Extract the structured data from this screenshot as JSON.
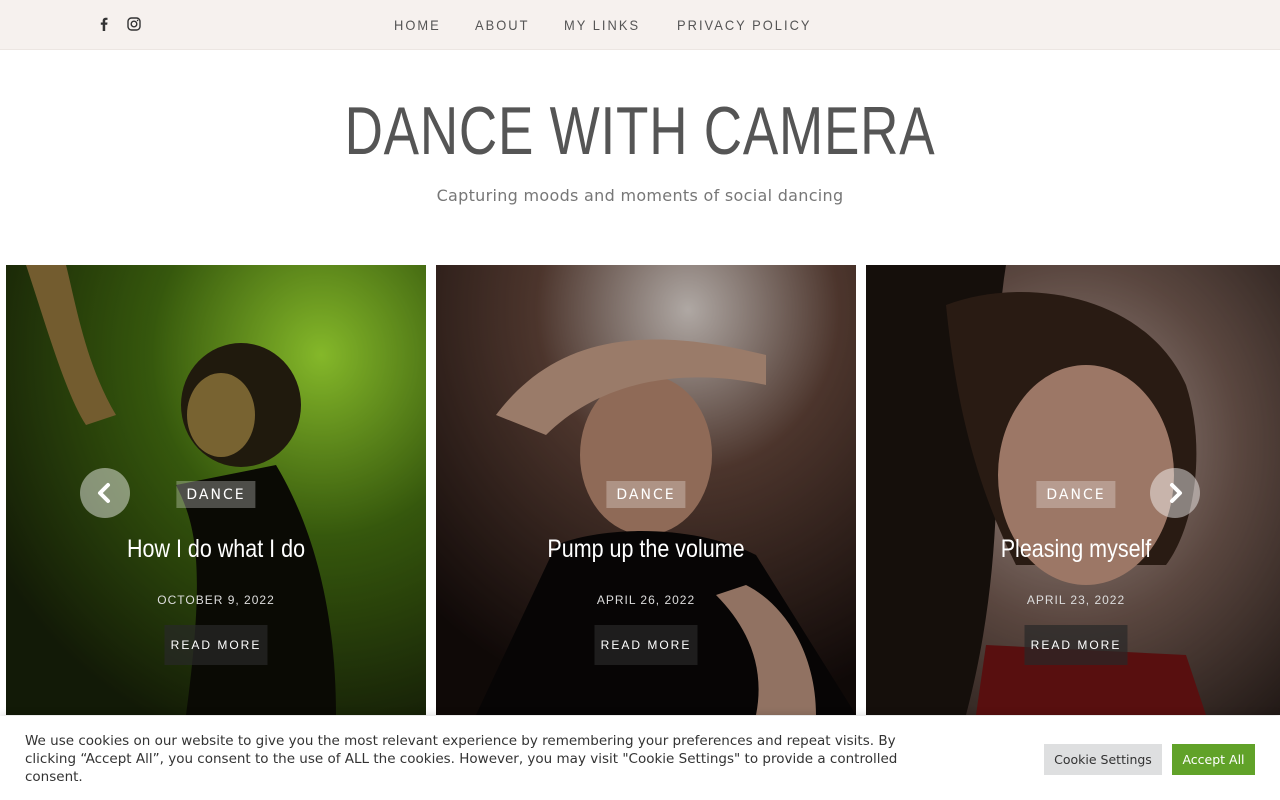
{
  "social": [
    {
      "name": "facebook-icon"
    },
    {
      "name": "instagram-icon"
    }
  ],
  "nav": {
    "items": [
      "HOME",
      "ABOUT",
      "MY LINKS",
      "PRIVACY POLICY"
    ]
  },
  "site": {
    "title": "DANCE WITH CAMERA",
    "tagline": "Capturing moods and moments of social dancing"
  },
  "slides": [
    {
      "category": "DANCE",
      "title": "How I do what I do",
      "date": "OCTOBER 9, 2022",
      "read_more": "READ MORE"
    },
    {
      "category": "DANCE",
      "title": "Pump up the volume",
      "date": "APRIL 26, 2022",
      "read_more": "READ MORE"
    },
    {
      "category": "DANCE",
      "title": "Pleasing myself",
      "date": "APRIL 23, 2022",
      "read_more": "READ MORE"
    }
  ],
  "cookie": {
    "text": "We use cookies on our website to give you the most relevant experience by remembering your preferences and repeat visits. By clicking “Accept All”, you consent to the use of ALL the cookies. However, you may visit \"Cookie Settings\" to provide a controlled consent.",
    "settings_label": "Cookie Settings",
    "accept_label": "Accept All"
  },
  "colors": {
    "topbar_bg": "#f6f1ee",
    "accept_green": "#61a229"
  }
}
